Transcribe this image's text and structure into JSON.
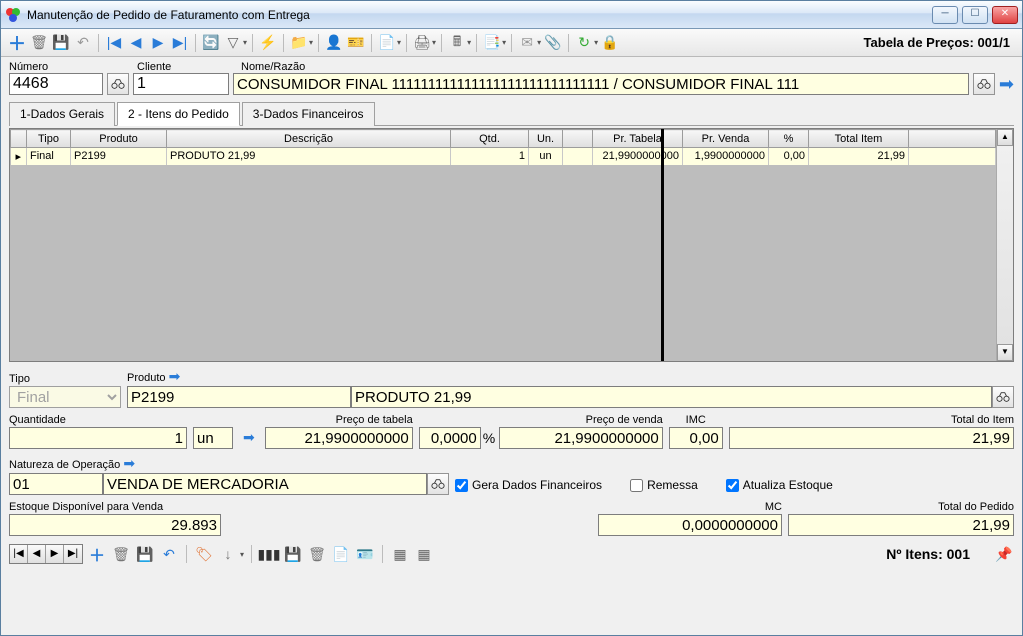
{
  "window": {
    "title": "Manutenção de Pedido de Faturamento com Entrega"
  },
  "toolbar": {
    "price_table_label": "Tabela de Preços: 001/1"
  },
  "header": {
    "numero_label": "Número",
    "numero_value": "4468",
    "cliente_label": "Cliente",
    "cliente_value": "1",
    "nome_label": "Nome/Razão",
    "nome_value": "CONSUMIDOR FINAL 111111111111111111111111111111 / CONSUMIDOR FINAL 111"
  },
  "tabs": {
    "t1": "1-Dados Gerais",
    "t2": "2 - Itens do Pedido",
    "t3": "3-Dados Financeiros"
  },
  "grid": {
    "cols": {
      "tipo": "Tipo",
      "produto": "Produto",
      "descricao": "Descrição",
      "qtd": "Qtd.",
      "un": "Un.",
      "prtab": "Pr. Tabela",
      "prven": "Pr. Venda",
      "pct": "%",
      "total": "Total Item"
    },
    "rows": [
      {
        "tipo": "Final",
        "produto": "P2199",
        "descricao": "PRODUTO 21,99",
        "qtd": "1",
        "un": "un",
        "prtab": "21,9900000000",
        "prven": "1,9900000000",
        "pct": "0,00",
        "total": "21,99"
      }
    ]
  },
  "form": {
    "tipo_label": "Tipo",
    "tipo_value": "Final",
    "produto_label": "Produto",
    "produto_value": "P2199",
    "produto_desc": "PRODUTO 21,99",
    "qtd_label": "Quantidade",
    "qtd_value": "1",
    "un_value": "un",
    "prtab_label": "Preço de tabela",
    "prtab_value": "21,9900000000",
    "pct_value": "0,0000",
    "pct_unit": "%",
    "prven_label": "Preço de venda",
    "prven_value": "21,9900000000",
    "imc_label": "IMC",
    "imc_value": "0,00",
    "totalitem_label": "Total do Item",
    "totalitem_value": "21,99",
    "natop_label": "Natureza de Operação",
    "natop_code": "01",
    "natop_desc": "VENDA DE MERCADORIA",
    "chk_gerafin": "Gera Dados Financeiros",
    "chk_remessa": "Remessa",
    "chk_atualiza": "Atualiza Estoque",
    "estoque_label": "Estoque Disponível para Venda",
    "estoque_value": "29.893",
    "mc_label": "MC",
    "mc_value": "0,0000000000",
    "totalped_label": "Total do Pedido",
    "totalped_value": "21,99"
  },
  "footer": {
    "nitens_label": "Nº Itens: 001"
  }
}
